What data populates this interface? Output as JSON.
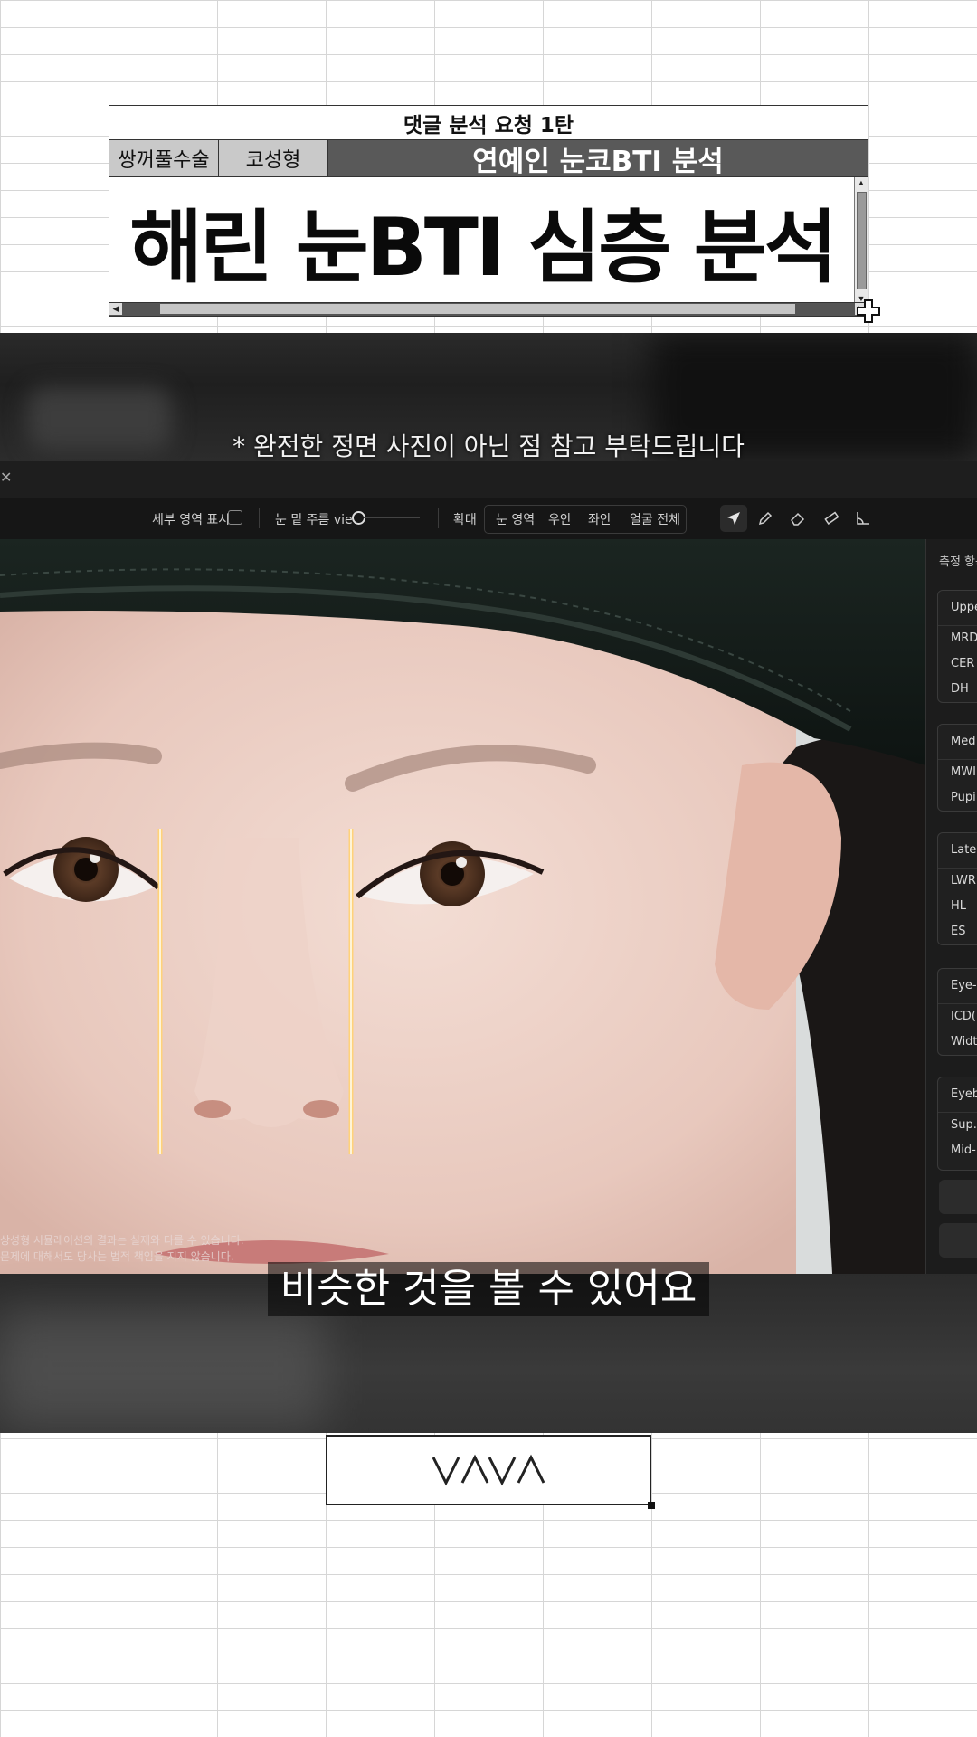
{
  "header": {
    "request_title": "댓글 분석 요청 1탄",
    "tag_1": "쌍꺼풀수술",
    "tag_2": "코성형",
    "section_title": "연예인 눈코BTI 분석",
    "main_title": "해린 눈BTI 심층 분석"
  },
  "video": {
    "notice": "* 완전한 정면 사진이 아닌 점 참고 부탁드립니다",
    "caption": "비슷한 것을 볼 수 있어요",
    "disclaimer_lines": [
      "상성형 시뮬레이션의 결과는 실제와 다를 수 있습니다.",
      "문제에 대해서도 당사는 법적 책임을 지지 않습니다."
    ]
  },
  "toolbar": {
    "detail_area_label": "세부 영역 표시",
    "wrinkle_view_label": "눈 밑 주름 view",
    "zoom_label": "확대",
    "zoom_options": [
      "눈 영역",
      "우안",
      "좌안",
      "얼굴 전체"
    ]
  },
  "side_panel": {
    "title": "측정 항목",
    "groups": [
      {
        "head": "Uppe",
        "items": [
          "MRD",
          "CER",
          "DH"
        ]
      },
      {
        "head": "Med",
        "items": [
          "MWI",
          "Pupi"
        ]
      },
      {
        "head": "Late",
        "items": [
          "LWR",
          "HL",
          "ES"
        ]
      },
      {
        "head": "Eye-",
        "items": [
          "ICD(",
          "Widt"
        ]
      },
      {
        "head": "Eyeb",
        "items": [
          "Sup.",
          "Mid-"
        ]
      }
    ]
  },
  "logo": {
    "text": "VAVA"
  },
  "colors": {
    "guide_line": "#ffd27a",
    "dark_panel": "#161616",
    "header_dark": "#595959"
  }
}
